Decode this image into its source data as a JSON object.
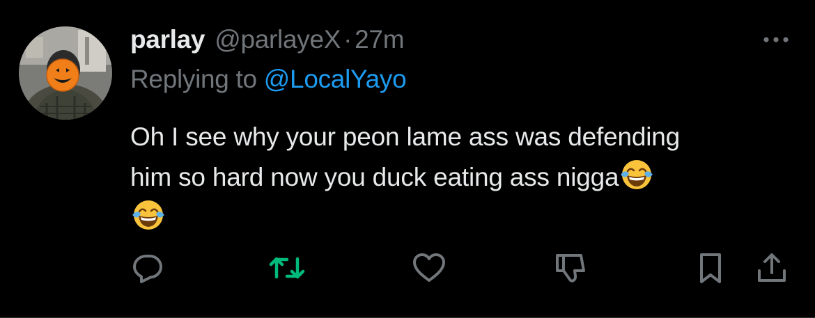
{
  "tweet": {
    "display_name": "parlay",
    "handle": "@parlayeX",
    "separator": "·",
    "timestamp": "27m",
    "replying_prefix": "Replying to ",
    "replying_to": "@LocalYayo",
    "text_lines": [
      "Oh I see why your peon lame ass was defending",
      "him so hard now you duck eating ass nigga"
    ],
    "emojis": [
      "face-with-tears-of-joy",
      "face-with-tears-of-joy"
    ]
  },
  "icons": {
    "more": "more-horizontal-icon",
    "reply": "reply-icon",
    "retweet": "retweet-icon",
    "like": "heart-icon",
    "dislike": "thumbs-down-icon",
    "bookmark": "bookmark-icon",
    "share": "share-icon"
  },
  "colors": {
    "background": "#000000",
    "text": "#e7e9ea",
    "secondary": "#71767b",
    "link": "#1d9bf0",
    "retweet_active": "#00ba7c",
    "border": "#2f3336"
  }
}
